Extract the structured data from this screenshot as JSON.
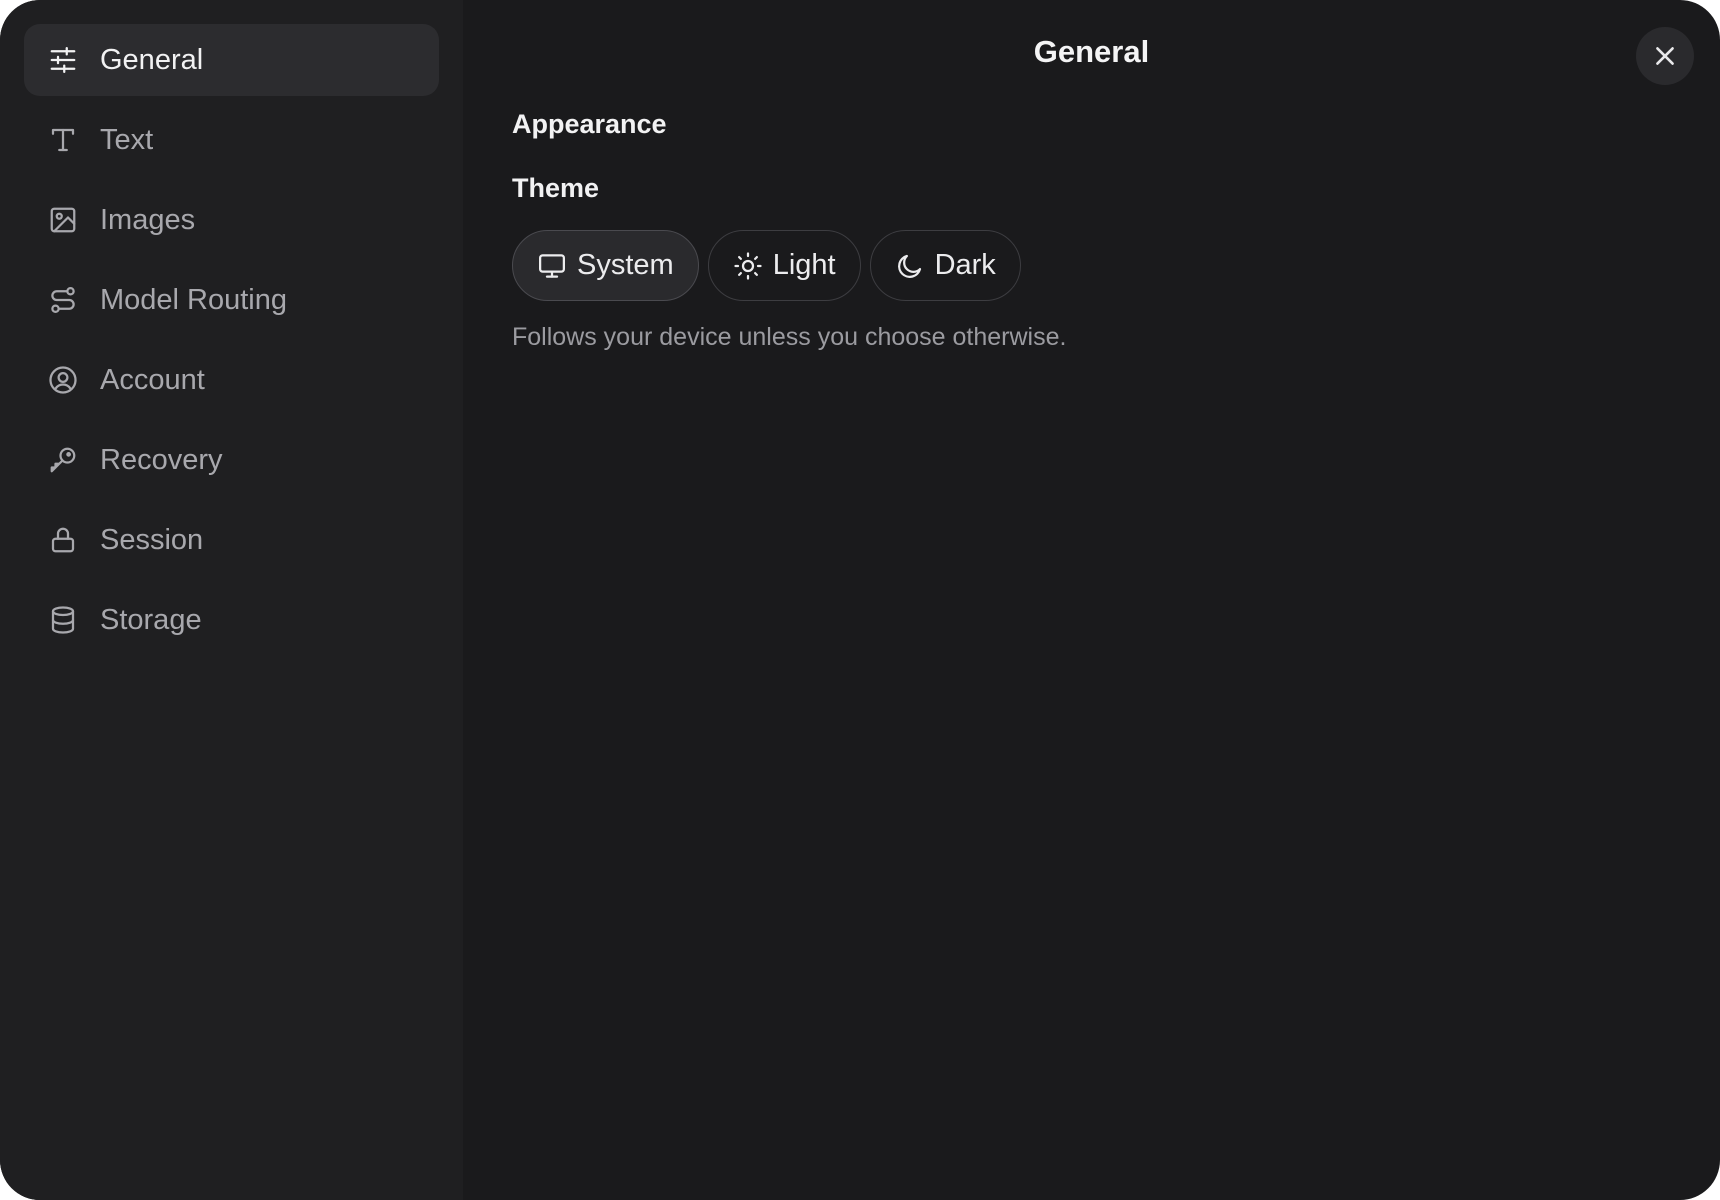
{
  "sidebar": {
    "items": [
      {
        "label": "General",
        "icon": "sliders-icon",
        "active": true
      },
      {
        "label": "Text",
        "icon": "text-icon"
      },
      {
        "label": "Images",
        "icon": "image-icon"
      },
      {
        "label": "Model Routing",
        "icon": "route-icon"
      },
      {
        "label": "Account",
        "icon": "user-circle-icon"
      },
      {
        "label": "Recovery",
        "icon": "key-icon"
      },
      {
        "label": "Session",
        "icon": "lock-icon"
      },
      {
        "label": "Storage",
        "icon": "database-icon"
      }
    ]
  },
  "header": {
    "title": "General"
  },
  "appearance": {
    "section_title": "Appearance",
    "theme_label": "Theme",
    "options": [
      {
        "label": "System",
        "icon": "monitor-icon",
        "selected": true
      },
      {
        "label": "Light",
        "icon": "sun-icon"
      },
      {
        "label": "Dark",
        "icon": "moon-icon"
      }
    ],
    "helper_text": "Follows your device unless you choose otherwise."
  },
  "colors": {
    "background": "#1a1a1c",
    "sidebar": "#1f1f21",
    "active_item": "#2c2c2f",
    "text_primary": "#f2f2f3",
    "text_secondary": "#a8a8ad"
  }
}
